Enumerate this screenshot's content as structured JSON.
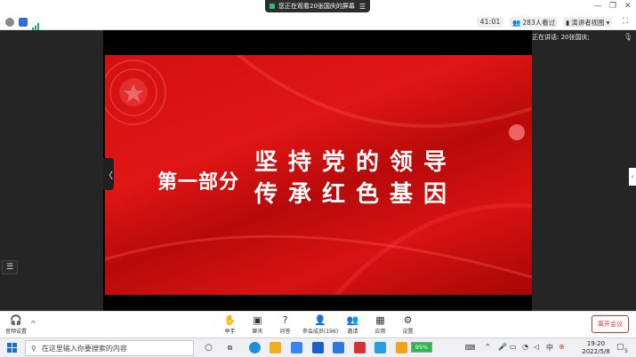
{
  "titlebar": {
    "share_banner": "您正在观看20张国庆的屏幕",
    "share_menu_icon": "menu-icon",
    "min": "—",
    "restore": "❐",
    "close": "✕"
  },
  "toolbar": {
    "info_icon": "info-icon",
    "shield_icon": "shield-icon",
    "signal_icon": "signal-icon",
    "timer": "41:01",
    "viewers": "283人看过",
    "view_mode": "演讲者视图",
    "view_caret": "▾",
    "fullscreen": "⛶"
  },
  "stage": {
    "speaking_label": "正在讲话: 20张国庆;",
    "slide": {
      "part": "第一部分",
      "line1": "坚持党的领导",
      "line2": "传承红色基因"
    },
    "prev_arrow": "〈",
    "list_icon": "☰",
    "side_tab": "‹"
  },
  "meeting_bar": {
    "audio": "音频设置",
    "audio_caret": "^",
    "buttons": [
      {
        "icon": "hand-icon",
        "glyph": "✋",
        "label": "举手"
      },
      {
        "icon": "chat-icon",
        "glyph": "▣",
        "label": "聊天"
      },
      {
        "icon": "qa-icon",
        "glyph": "?",
        "label": "问答"
      },
      {
        "icon": "participants-icon",
        "glyph": "👤",
        "label": "参会成员(196)"
      },
      {
        "icon": "invite-icon",
        "glyph": "👥",
        "label": "邀请"
      },
      {
        "icon": "apps-icon",
        "glyph": "▦",
        "label": "应用"
      },
      {
        "icon": "settings-icon",
        "glyph": "⚙",
        "label": "设置"
      }
    ],
    "leave": "离开会议"
  },
  "taskbar": {
    "search_placeholder": "在这里输入你要搜索的内容",
    "battery": "95%",
    "time": "19:20",
    "date": "2022/5/8",
    "notif_count": "5",
    "tray_up": "^",
    "ime": "中"
  }
}
